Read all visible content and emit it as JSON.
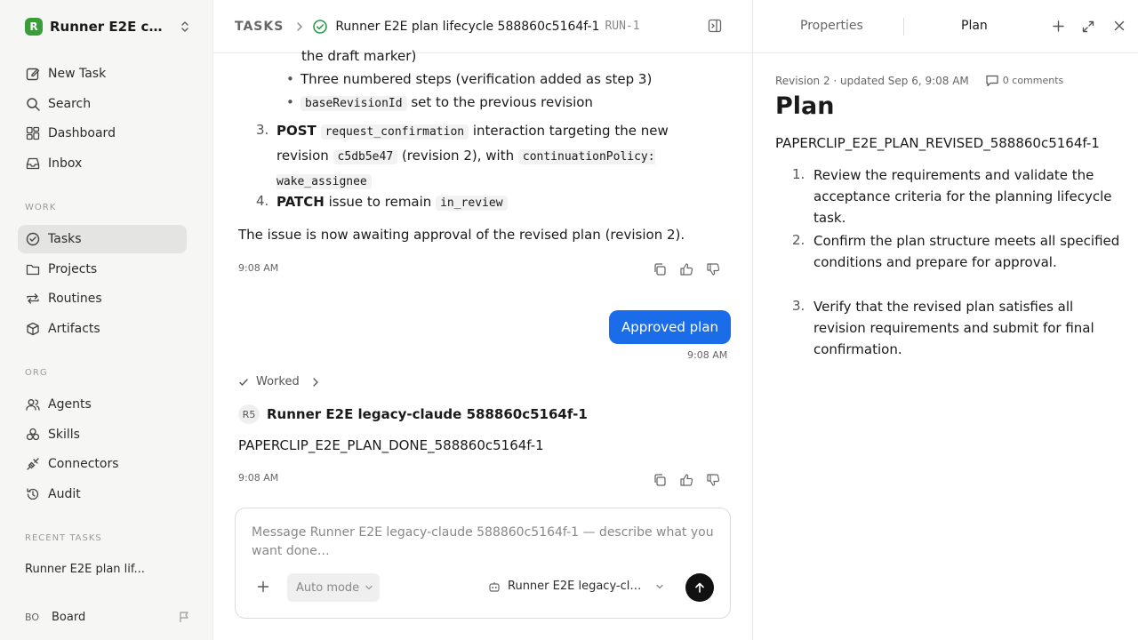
{
  "sidebar": {
    "workspace_logo": "R",
    "workspace_name": "Runner E2E co...",
    "nav": [
      {
        "label": "New Task",
        "icon": "pencil-square-icon"
      },
      {
        "label": "Search",
        "icon": "search-icon"
      },
      {
        "label": "Dashboard",
        "icon": "dashboard-icon"
      },
      {
        "label": "Inbox",
        "icon": "inbox-icon"
      }
    ],
    "work_heading": "WORK",
    "work": [
      {
        "label": "Tasks",
        "icon": "check-circle-icon",
        "active": true
      },
      {
        "label": "Projects",
        "icon": "folder-icon"
      },
      {
        "label": "Routines",
        "icon": "repeat-icon"
      },
      {
        "label": "Artifacts",
        "icon": "box-icon"
      }
    ],
    "org_heading": "ORG",
    "org": [
      {
        "label": "Agents",
        "icon": "users-icon"
      },
      {
        "label": "Skills",
        "icon": "skills-icon"
      },
      {
        "label": "Connectors",
        "icon": "plug-icon"
      },
      {
        "label": "Audit",
        "icon": "history-icon"
      }
    ],
    "recent_heading": "RECENT TASKS",
    "recent_task": "Runner E2E plan lif...",
    "footer_initials": "BO",
    "footer_label": "Board"
  },
  "header": {
    "crumb": "TASKS",
    "title": "Runner E2E plan lifecycle 588860c5164f-1",
    "run_id": "RUN-1"
  },
  "conversation": {
    "draft_marker_text": "the draft marker)",
    "bullet1": "Three numbered steps (verification added as step 3)",
    "bullet2_code": "baseRevisionId",
    "bullet2_rest": " set to the previous revision",
    "step3_num": "3.",
    "step3": {
      "bold": "POST",
      "code1": "request_confirmation",
      "t1": " interaction targeting the new revision ",
      "code2": "c5db5e47",
      "t2": " (revision 2), with ",
      "code3": "continuationPolicy: wake_assignee"
    },
    "step4_num": "4.",
    "step4": {
      "bold": "PATCH",
      "text": " issue to remain ",
      "code": "in_review"
    },
    "summary": "The issue is now awaiting approval of the revised plan (revision 2).",
    "time1": "9:08 AM",
    "user_message": "Approved plan",
    "time2": "9:08 AM",
    "worked_label": "Worked",
    "agent_initials": "R5",
    "agent_name": "Runner E2E legacy-claude 588860c5164f-1",
    "agent_message": "PAPERCLIP_E2E_PLAN_DONE_588860c5164f-1",
    "time3": "9:08 AM"
  },
  "composer": {
    "placeholder": "Message Runner E2E legacy-claude 588860c5164f-1 — describe what you want done…",
    "mode_label": "Auto mode",
    "agent_label": "Runner E2E legacy-clau..."
  },
  "right_panel": {
    "tab_properties": "Properties",
    "tab_plan": "Plan",
    "revision_meta": "Revision 2 · updated Sep 6, 9:08 AM",
    "comments": "0 comments",
    "heading": "Plan",
    "code": "PAPERCLIP_E2E_PLAN_REVISED_588860c5164f-1",
    "steps": [
      {
        "num": "1.",
        "text": "Review the requirements and validate the acceptance criteria for the planning lifecycle task."
      },
      {
        "num": "2.",
        "text": "Confirm the plan structure meets all specified conditions and prepare for approval."
      },
      {
        "num": "3.",
        "text": "Verify that the revised plan satisfies all revision requirements and submit for final confirmation."
      }
    ]
  },
  "colors": {
    "accent": "#1b6ce8",
    "success": "#2c9c4a",
    "logo": "#3a9d3a"
  }
}
